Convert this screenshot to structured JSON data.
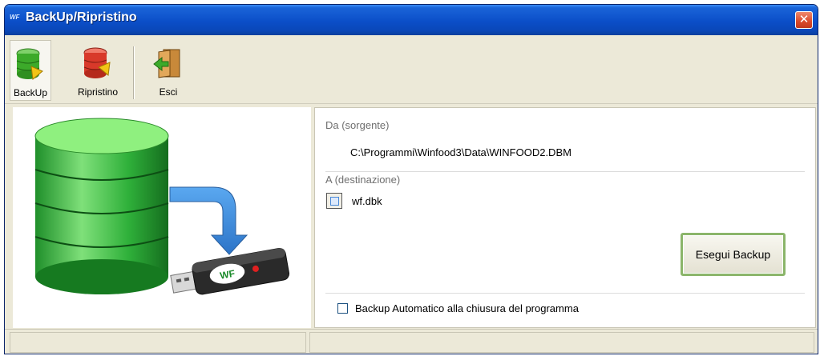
{
  "window": {
    "title": "BackUp/Ripristino",
    "title_logo": "WF",
    "close_symbol": "✕"
  },
  "toolbar": {
    "items": [
      {
        "label": "BackUp",
        "icon": "database-backup-icon",
        "selected": true
      },
      {
        "label": "Ripristino",
        "icon": "database-restore-icon",
        "selected": false
      },
      {
        "label": "Esci",
        "icon": "exit-door-icon",
        "selected": false
      }
    ]
  },
  "illustration": {
    "icon": "database-to-usb-icon",
    "usb_logo": "WF"
  },
  "form": {
    "source_label": "Da (sorgente)",
    "source_path": "C:\\Programmi\\Winfood3\\Data\\WINFOOD2.DBM",
    "dest_label": "A (destinazione)",
    "dest_file": "wf.dbk",
    "execute_button": "Esegui Backup",
    "auto_backup_label": "Backup Automatico alla chiusura del programma",
    "auto_backup_checked": false
  },
  "colors": {
    "titlebar": "#0b4ec8",
    "window_bg": "#ece9d8",
    "execute_border": "#8bb56a",
    "close_button": "#d9492a"
  }
}
